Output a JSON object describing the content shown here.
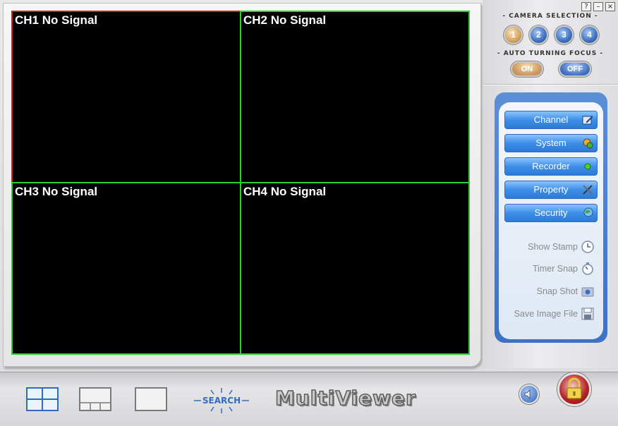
{
  "channels": [
    {
      "id": "ch1",
      "label": "CH1 No Signal",
      "selected": true
    },
    {
      "id": "ch2",
      "label": "CH2 No Signal",
      "selected": false
    },
    {
      "id": "ch3",
      "label": "CH3 No Signal",
      "selected": false
    },
    {
      "id": "ch4",
      "label": "CH4 No Signal",
      "selected": false
    }
  ],
  "window_controls": {
    "help": "?",
    "minimize": "–",
    "close": "×"
  },
  "camera_selection": {
    "title": "- CAMERA SELECTION -",
    "buttons": [
      "1",
      "2",
      "3",
      "4"
    ],
    "active": "1"
  },
  "auto_focus": {
    "title": "- AUTO TURNING FOCUS -",
    "on_label": "ON",
    "off_label": "OFF",
    "state": "ON"
  },
  "menu": {
    "channel": "Channel",
    "system": "System",
    "recorder": "Recorder",
    "property": "Property",
    "security": "Security"
  },
  "tools": {
    "show_stamp": "Show Stamp",
    "timer_snap": "Timer Snap",
    "snap_shot": "Snap Shot",
    "save_image_file": "Save Image File"
  },
  "bottom": {
    "search_label": "SEARCH",
    "logo_text": "MultiViewer"
  },
  "colors": {
    "selected_border": "#d62020",
    "channel_border": "#2ecc2e",
    "accent_blue": "#3e8fe8"
  }
}
